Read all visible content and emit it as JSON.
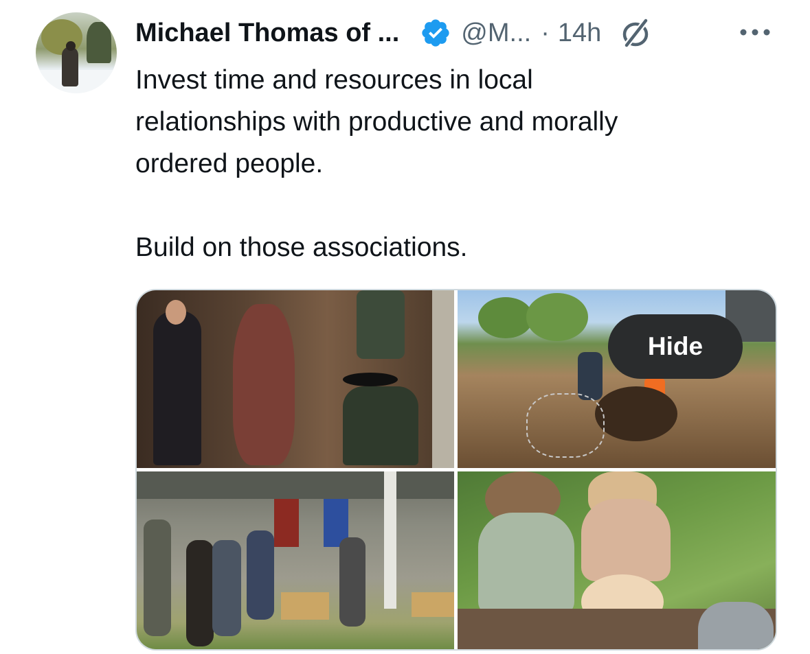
{
  "tweet": {
    "display_name": "Michael Thomas of ...",
    "verified": true,
    "handle": "@M...",
    "separator": "·",
    "time": "14h",
    "grok_icon": "grok-slash-circle-icon",
    "more_icon": "more-horizontal-icon",
    "text_lines": [
      "Invest time and resources in local",
      "relationships with productive and morally",
      "ordered people.",
      "",
      "Build on those associations."
    ]
  },
  "media": {
    "photo_count": 4,
    "hide_label": "Hide"
  },
  "colors": {
    "text_primary": "#0f1419",
    "text_secondary": "#536471",
    "verified_blue": "#1d9bf0",
    "hide_button_bg": "#2a2c2d",
    "media_border": "#cfd9de"
  }
}
